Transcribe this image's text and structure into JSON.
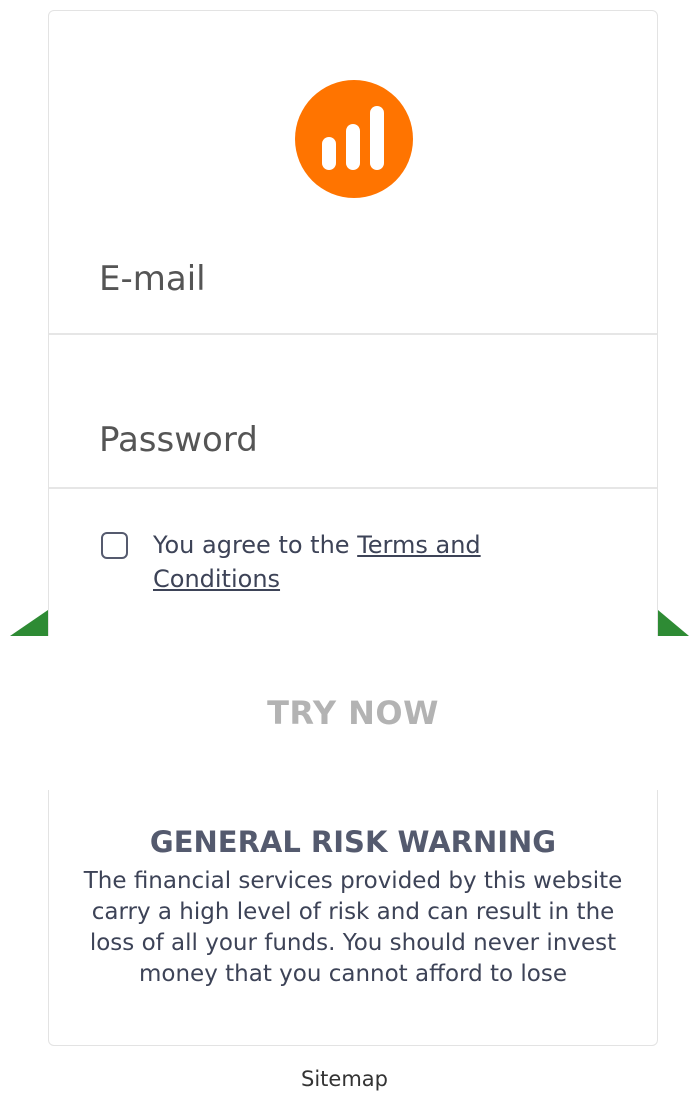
{
  "form": {
    "email_placeholder": "E-mail",
    "password_placeholder": "Password",
    "agree_prefix": "You agree to the ",
    "terms_link": "Terms and Conditions",
    "agree_checked": false,
    "submit_label": "TRY NOW"
  },
  "warning": {
    "title": "GENERAL RISK WARNING",
    "body": "The financial services provided by this website carry a high level of risk and can result in the loss of all your funds. You should never invest money that you cannot afford to lose"
  },
  "footer": {
    "sitemap_label": "Sitemap"
  },
  "colors": {
    "brand": "#ff7400",
    "ribbon": "#2e8b34",
    "button_text": "#b3b3b3",
    "warning_title": "#545a6e"
  },
  "icons": {
    "logo": "bar-chart-logo-icon",
    "checkbox": "checkbox-unchecked-icon"
  }
}
